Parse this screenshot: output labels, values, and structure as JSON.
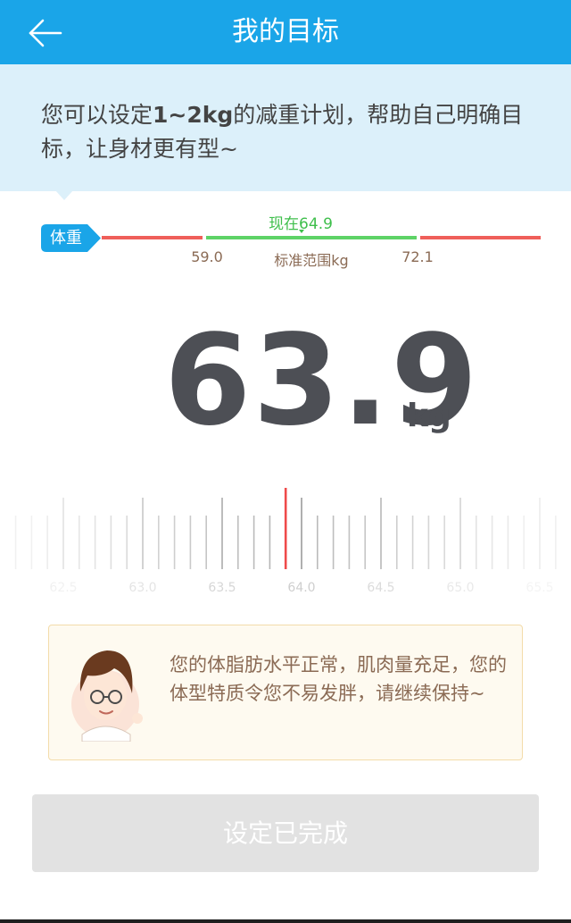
{
  "header": {
    "title": "我的目标",
    "back_icon": "arrow-left-icon",
    "bg_color": "#1aa5e8"
  },
  "intro": {
    "text": "您可以设定1~2kg的减重计划，帮助自己明确目标，让身材更有型~",
    "text_before": "您可以设定",
    "highlight": "1~2kg",
    "text_after": "的减重计划，帮助自己明确目标，让身材更有型~"
  },
  "weight_range": {
    "tag": "体重",
    "current_label": "现在64.9",
    "low": "59.0",
    "high": "72.1",
    "range_title": "标准范围kg",
    "colors": {
      "normal": "#5ed367",
      "out_of_range": "#ef5f5a"
    }
  },
  "target": {
    "value": "63.9",
    "unit": "kg"
  },
  "ruler": {
    "labels": [
      "62.5",
      "63.0",
      "63.5",
      "64.0",
      "64.5",
      "65.0",
      "65.5"
    ],
    "selected": 63.9,
    "indicator_color": "#ef4b4b"
  },
  "tip": {
    "avatar_icon": "coach-avatar-icon",
    "text": "您的体脂肪水平正常，肌肉量充足，您的体型特质令您不易发胖，请继续保持~"
  },
  "done_button": {
    "label": "设定已完成",
    "enabled": false
  }
}
